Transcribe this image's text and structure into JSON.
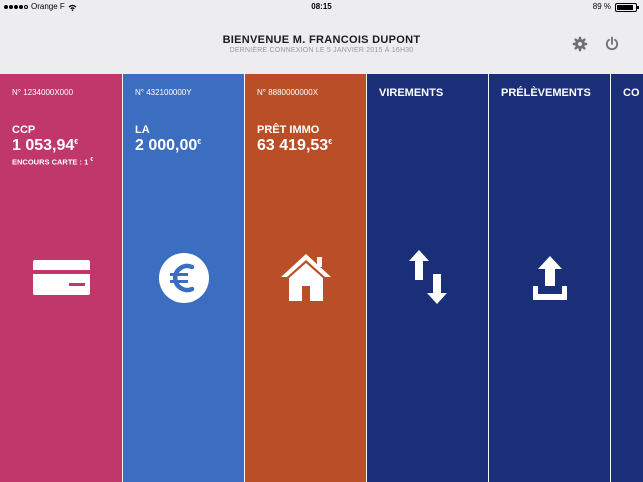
{
  "status_bar": {
    "carrier": "Orange F",
    "time": "08:15",
    "battery": "89 %",
    "battery_level": 0.89
  },
  "header": {
    "title": "BIENVENUE M. FRANCOIS DUPONT",
    "subtitle": "DERNIÈRE CONNEXION LE 5 JANVIER 2015 À 16H30"
  },
  "accounts": [
    {
      "number": "N° 1234000X000",
      "name": "CCP",
      "amount": "1 053,94",
      "currency": "€",
      "encours": "ENCOURS CARTE : 1",
      "encours_currency": "€",
      "icon": "credit-card-icon",
      "color": "#c0376c"
    },
    {
      "number": "N° 432100000Y",
      "name": "LA",
      "amount": "2 000,00",
      "currency": "€",
      "icon": "euro-icon",
      "color": "#3b6ec0"
    },
    {
      "number": "N° 8880000000X",
      "name": "PRÊT IMMO",
      "amount": "63 419,53",
      "currency": "€",
      "icon": "home-icon",
      "color": "#b94e27"
    }
  ],
  "actions": [
    {
      "label": "VIREMENTS",
      "icon": "transfer-arrows-icon",
      "color": "#1a2f78"
    },
    {
      "label": "PRÉLÈVEMENTS",
      "icon": "upload-icon",
      "color": "#1a2f78"
    },
    {
      "label": "CO",
      "color": "#1a2f78"
    }
  ]
}
